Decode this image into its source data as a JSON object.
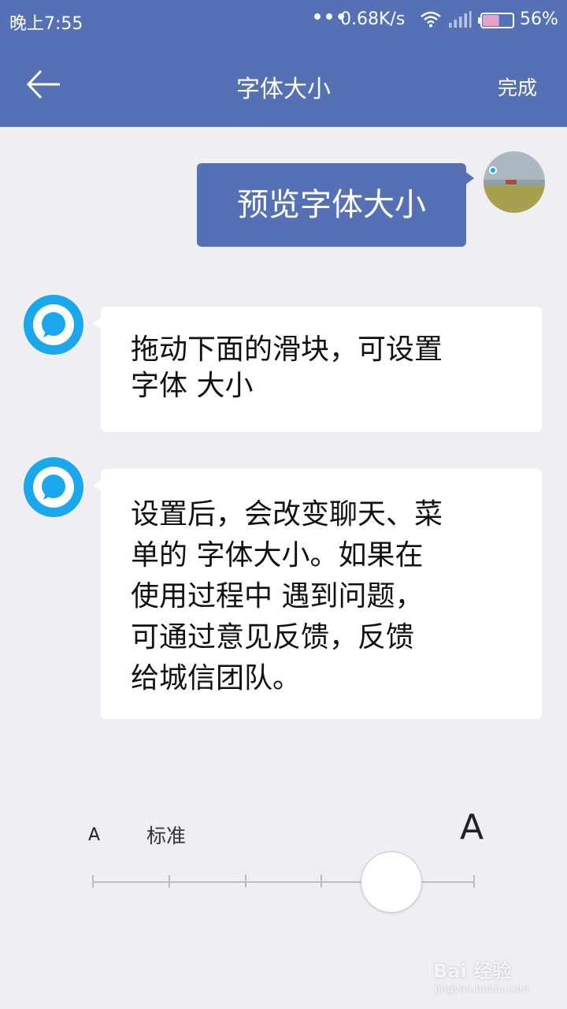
{
  "status_bar": {
    "time": "晚上7:55",
    "dots": "•••",
    "network_speed": "0.68K/s",
    "battery_percent": "56%",
    "battery_level": 0.56,
    "icons": [
      "wifi-icon",
      "signal-icon",
      "battery-icon"
    ]
  },
  "app_bar": {
    "back_icon": "arrow-left-icon",
    "title": "字体大小",
    "done_label": "完成"
  },
  "messages": {
    "preview": "预览字体大小",
    "bot_1_line1": "拖动下面的滑块，可设置",
    "bot_1_line2": "字体 大小",
    "bot_2_line1": "设置后，会改变聊天、菜",
    "bot_2_line2": "单的 字体大小。如果在",
    "bot_2_line3": "使用过程中 遇到问题，",
    "bot_2_line4": "可通过意见反馈，反馈",
    "bot_2_line5": "给城信团队。"
  },
  "font_size_slider": {
    "small_label": "A",
    "standard_label": "标准",
    "large_label": "A",
    "steps": 6,
    "selected_step_index": 4
  },
  "watermark": {
    "text": "Bai 经验",
    "sub": "jingyan.baidu.com"
  },
  "colors": {
    "primary": "#5570b5",
    "background": "#eeeef3",
    "bot_avatar": "#1aa7ec"
  }
}
